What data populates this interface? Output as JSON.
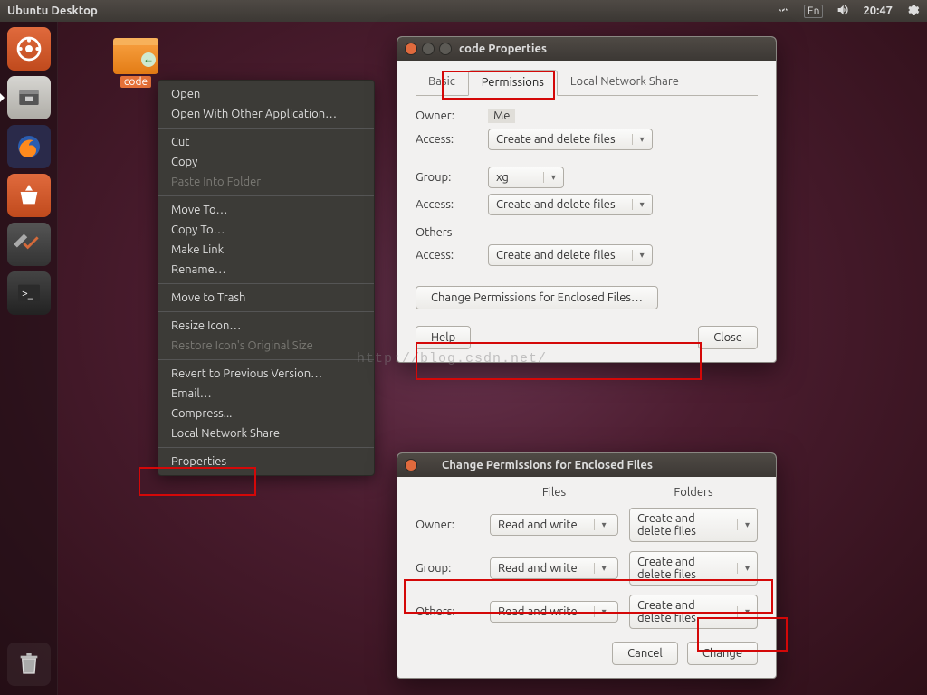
{
  "topbar": {
    "title": "Ubuntu Desktop",
    "lang": "En",
    "clock": "20:47"
  },
  "desktop": {
    "folder_name": "code"
  },
  "launcher": {
    "items": [
      "dash",
      "files",
      "firefox",
      "software",
      "settings",
      "terminal"
    ],
    "trash": "trash"
  },
  "context_menu": {
    "open": "Open",
    "open_with": "Open With Other Application…",
    "cut": "Cut",
    "copy": "Copy",
    "paste_into": "Paste Into Folder",
    "move_to": "Move To…",
    "copy_to": "Copy To…",
    "make_link": "Make Link",
    "rename": "Rename…",
    "move_trash": "Move to Trash",
    "resize_icon": "Resize Icon…",
    "restore_icon": "Restore Icon's Original Size",
    "revert": "Revert to Previous Version…",
    "email": "Email…",
    "compress": "Compress...",
    "lns": "Local Network Share",
    "properties": "Properties"
  },
  "props": {
    "title": "code Properties",
    "tabs": {
      "basic": "Basic",
      "permissions": "Permissions",
      "lns": "Local Network Share"
    },
    "owner_lbl": "Owner:",
    "owner_val": "Me",
    "access_lbl": "Access:",
    "owner_access": "Create and delete files",
    "group_lbl": "Group:",
    "group_val": "xg",
    "group_access": "Create and delete files",
    "others_hdr": "Others",
    "others_access": "Create and delete files",
    "change_enclosed": "Change Permissions for Enclosed Files…",
    "help": "Help",
    "close": "Close"
  },
  "change": {
    "title": "Change Permissions for Enclosed Files",
    "files_hdr": "Files",
    "folders_hdr": "Folders",
    "owner_lbl": "Owner:",
    "group_lbl": "Group:",
    "others_lbl": "Others:",
    "owner_files": "Read and write",
    "owner_folders": "Create and delete files",
    "group_files": "Read and write",
    "group_folders": "Create and delete files",
    "others_files": "Read and write",
    "others_folders": "Create and delete files",
    "cancel": "Cancel",
    "change": "Change"
  },
  "watermark": "http://blog.csdn.net/"
}
